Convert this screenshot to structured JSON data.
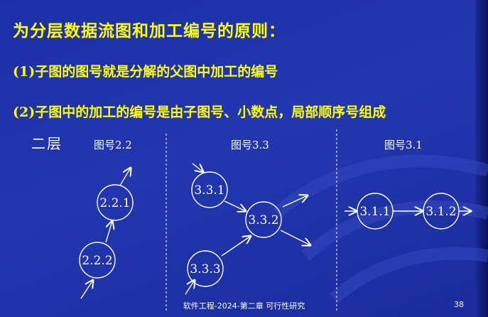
{
  "slide": {
    "title": "为分层数据流图和加工编号的原则：",
    "rules": [
      "(1)子图的图号就是分解的父图中加工的编号",
      "(2)子图中的加工的编号是由子图号、小数点，局部顺序号组成"
    ],
    "level_label": "二层",
    "diagrams": [
      {
        "label": "图号2.2",
        "nodes": [
          "2.2.1",
          "2.2.2"
        ]
      },
      {
        "label": "图号3.3",
        "nodes": [
          "3.3.1",
          "3.3.2",
          "3.3.3"
        ]
      },
      {
        "label": "图号3.1",
        "nodes": [
          "3.1.1",
          "3.1.2"
        ]
      }
    ],
    "footer": "软件工程-2024-第二章 可行性研究",
    "page_number": "38"
  },
  "colors": {
    "background": "#2236b0",
    "title_text": "#ffff00",
    "body_text": "#ffffff"
  }
}
